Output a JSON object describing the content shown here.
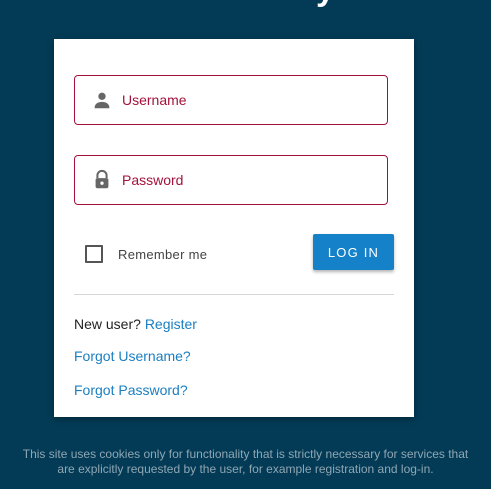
{
  "header": {
    "title_fragment": "y"
  },
  "login": {
    "username_placeholder": "Username",
    "password_placeholder": "Password",
    "remember_label": "Remember me",
    "remember_checked": false,
    "login_button": "LOG IN",
    "new_user_text": "New user?",
    "register_link": "Register",
    "forgot_username_link": "Forgot Username?",
    "forgot_password_link": "Forgot Password?",
    "icons": {
      "username": "person-icon",
      "password": "lock-icon"
    }
  },
  "footer": {
    "cookie_line1": "This site uses cookies only for functionality that is strictly necessary for services that",
    "cookie_line2": "are explicitly requested by the user, for example registration and log-in."
  },
  "colors": {
    "background": "#033b56",
    "field_accent": "#a3123a",
    "button": "#1481c9",
    "link": "#1a7fc0"
  }
}
